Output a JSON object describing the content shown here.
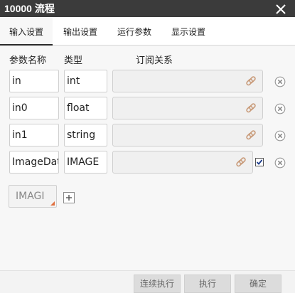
{
  "window": {
    "title": "10000 流程"
  },
  "tabs": [
    {
      "label": "输入设置",
      "active": true
    },
    {
      "label": "输出设置",
      "active": false
    },
    {
      "label": "运行参数",
      "active": false
    },
    {
      "label": "显示设置",
      "active": false
    }
  ],
  "columns": {
    "name": "参数名称",
    "type": "类型",
    "subscription": "订阅关系"
  },
  "params": [
    {
      "name": "in",
      "type": "int",
      "checked": false
    },
    {
      "name": "in0",
      "type": "float",
      "checked": false
    },
    {
      "name": "in1",
      "type": "string",
      "checked": false
    },
    {
      "name": "ImageDat",
      "type": "IMAGE",
      "checked": true
    }
  ],
  "new_param": {
    "type_value": "IMAGI"
  },
  "footer": {
    "continuous_run": "连续执行",
    "run": "执行",
    "confirm": "确定"
  },
  "colors": {
    "titlebar": "#3b3b3b",
    "background": "#f7f7f7",
    "accent": "#e07040"
  },
  "icons": {
    "close": "close-icon",
    "link": "link-icon",
    "delete": "delete-circle-icon",
    "add": "plus-icon"
  }
}
